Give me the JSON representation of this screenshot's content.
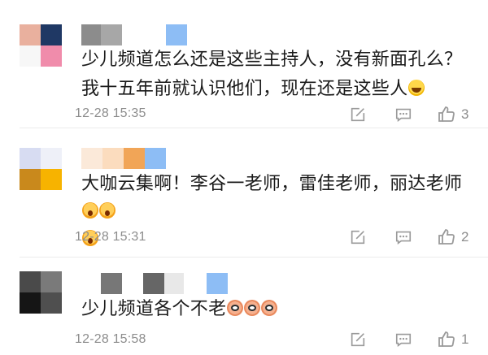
{
  "comments": [
    {
      "text": "少儿频道怎么还是这些主持人，没有新面孔么？我十五年前就认识他们，现在还是这些人",
      "emoji": "laughing-tears",
      "time": "12-28 15:35",
      "likes": "3"
    },
    {
      "text": "大咖云集啊！李谷一老师，雷佳老师，丽达老师",
      "emoji": "shocked-face",
      "time": "12-28 15:31",
      "likes": "2"
    },
    {
      "text": "少儿频道各个不老",
      "emoji": "cookie-face",
      "time": "12-28 15:58",
      "likes": "1"
    }
  ],
  "icons": {
    "edit": "edit-icon",
    "reply": "comment-icon",
    "like": "thumbs-up-icon"
  },
  "colors": {
    "text": "#1a1a1a",
    "meta": "#8d8d8d",
    "icon": "#9a9a9a"
  }
}
